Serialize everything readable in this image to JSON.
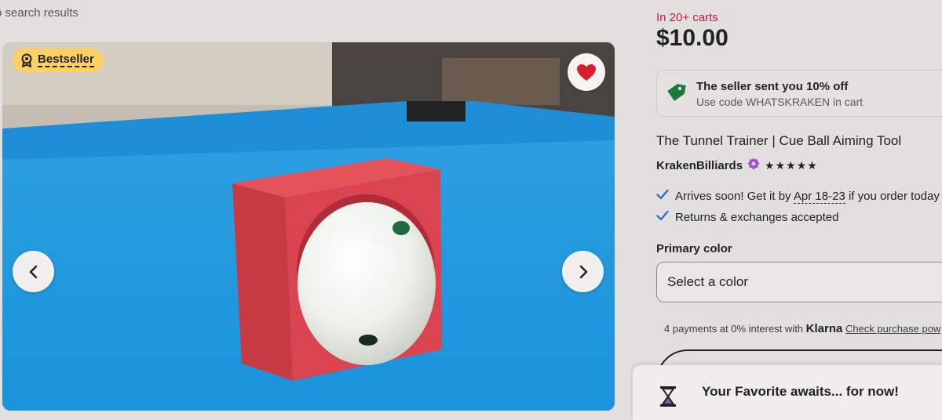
{
  "nav": {
    "back_link": "o search results"
  },
  "gallery": {
    "badge_label": "Bestseller",
    "badge_color": "#fdd061",
    "favorite_color": "#d5202d",
    "icons": [
      "award-icon",
      "heart-icon",
      "chevron-left-icon",
      "chevron-right-icon"
    ]
  },
  "product": {
    "carts_text": "In 20+ carts",
    "carts_color": "#c71c3b",
    "price": "$10.00",
    "coupon_title": "The seller sent you 10% off",
    "coupon_sub": "Use code WHATSKRAKEN in cart",
    "title": "The Tunnel Trainer | Cue Ball Aiming Tool",
    "shop_name": "KrakenBilliards",
    "stars": "★★★★★",
    "rating": 5,
    "arrives_pre": "Arrives soon! Get it by ",
    "arrives_date": "Apr 18-23",
    "arrives_post": " if you order today",
    "returns": "Returns & exchanges accepted",
    "color_label": "Primary color",
    "color_select": "Select a color",
    "klarna_pre": "4 payments at 0% interest with ",
    "klarna_brand": "Klarna",
    "klarna_link": "Check purchase pow"
  },
  "toast": {
    "message": "Your Favorite awaits... for now!"
  }
}
